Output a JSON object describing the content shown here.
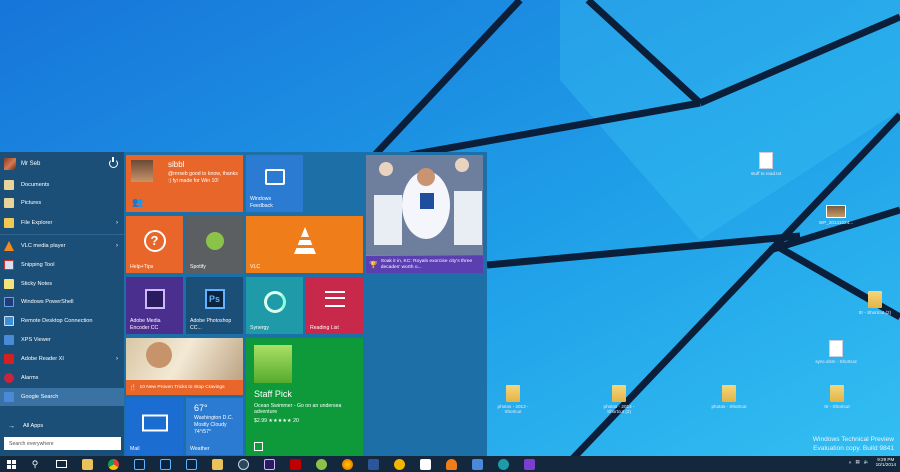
{
  "start_menu": {
    "user_name": "Mr Seb",
    "items": [
      {
        "label": "Documents",
        "icon": "documents-icon",
        "arrow": ""
      },
      {
        "label": "Pictures",
        "icon": "pictures-icon",
        "arrow": ""
      },
      {
        "label": "File Explorer",
        "icon": "file-explorer-icon",
        "arrow": "›"
      },
      {
        "label": "VLC media player",
        "icon": "vlc-icon",
        "arrow": "›"
      },
      {
        "label": "Snipping Tool",
        "icon": "snipping-tool-icon",
        "arrow": ""
      },
      {
        "label": "Sticky Notes",
        "icon": "sticky-notes-icon",
        "arrow": ""
      },
      {
        "label": "Windows PowerShell",
        "icon": "powershell-icon",
        "arrow": ""
      },
      {
        "label": "Remote Desktop Connection",
        "icon": "remote-desktop-icon",
        "arrow": ""
      },
      {
        "label": "XPS Viewer",
        "icon": "xps-viewer-icon",
        "arrow": ""
      },
      {
        "label": "Adobe Reader XI",
        "icon": "adobe-reader-icon",
        "arrow": "›"
      },
      {
        "label": "Alarms",
        "icon": "alarms-icon",
        "arrow": ""
      },
      {
        "label": "Google Search",
        "icon": "google-search-icon",
        "arrow": ""
      }
    ],
    "all_apps": "All Apps",
    "search_placeholder": "Search everywhere"
  },
  "tiles": {
    "sibbl": {
      "name": "sibbl",
      "text": "@mrseb good to know, thanks :) fyi made for Win 10!"
    },
    "windows_feedback": {
      "label": "Windows Feedback"
    },
    "sports": {
      "text": "Soak it in, KC: Royals exorcise city's three decades' worth o..."
    },
    "help_tips": {
      "label": "Help+Tips"
    },
    "spotify": {
      "label": "Spotify"
    },
    "vlc": {
      "label": "VLC"
    },
    "media_encoder": {
      "label": "Adobe Media Encoder CC"
    },
    "photoshop": {
      "label": "Adobe Photoshop CC..."
    },
    "synergy": {
      "label": "Synergy"
    },
    "reading_list": {
      "label": "Reading List"
    },
    "food": {
      "text": "10 New Proven Tricks to Stop Cravings"
    },
    "store": {
      "title": "Staff Pick",
      "text": "Ocean Swimmer - Go on an undersea adventure",
      "price": "$2.99 ★★★★★ 20"
    },
    "mail": {
      "label": "Mail"
    },
    "weather": {
      "temp": "67°",
      "location": "Washington D.C.",
      "condition": "Mostly Cloudy",
      "range": "74°/57°",
      "label": "Weather"
    }
  },
  "desktop": {
    "icons": [
      {
        "label": "stuff to read.txt",
        "kind": "doc"
      },
      {
        "label": "WP_20141024...",
        "kind": "photo"
      },
      {
        "label": "ttr - Shortcut (2)",
        "kind": "folder"
      },
      {
        "label": "sync.xlsm - Shortcut",
        "kind": "doc"
      },
      {
        "label": "photos - 2013 - Shortcut",
        "kind": "folder"
      },
      {
        "label": "photos - 2014 - Shortcut (2)",
        "kind": "folder"
      },
      {
        "label": "photos - Shortcut",
        "kind": "folder"
      },
      {
        "label": "ttr - Shortcut",
        "kind": "folder"
      }
    ],
    "watermark": [
      "Windows Technical Preview",
      "Evaluation copy. Build 9841"
    ]
  },
  "taskbar": {
    "time": "9:29 PM",
    "date": "10/1/2014",
    "buttons": [
      "start-icon",
      "search-icon",
      "task-view-icon",
      "file-explorer-icon",
      "chrome-icon",
      "photoshop-icon",
      "photoshop-icon",
      "photoshop-icon",
      "folder-icon",
      "steam-icon",
      "media-encoder-icon",
      "filezilla-icon",
      "spotify-icon",
      "firefox-icon",
      "word-icon",
      "chrome-canary-icon",
      "store-icon",
      "vlc-icon",
      "network-icon",
      "synergy-icon",
      "settings-icon"
    ]
  },
  "colors": {
    "desktop": "#1a9be8",
    "start_bg": "#1d6fa8",
    "left_pane": "#1b4f78",
    "tile_orange": "#e8662a",
    "tile_blue": "#2a7bd1",
    "tile_purple": "#5b3eb0",
    "tile_green": "#0e9a3a",
    "tile_red": "#c8284a"
  }
}
